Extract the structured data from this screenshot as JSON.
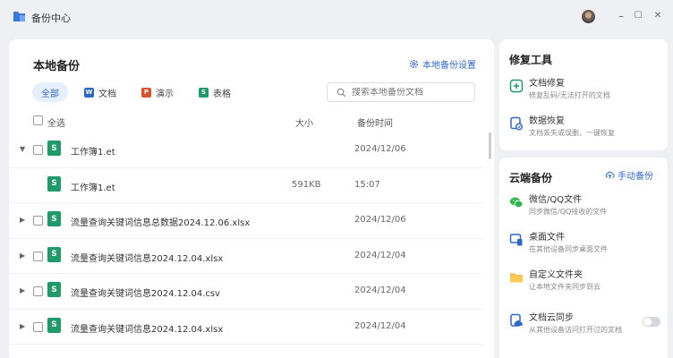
{
  "app": {
    "title": "备份中心"
  },
  "window": {
    "minimize": "–",
    "maximize": "☐",
    "close": "✕"
  },
  "main": {
    "title": "本地备份",
    "settings_label": "本地备份设置",
    "filters": [
      {
        "label": "全部",
        "active": true
      },
      {
        "label": "文档",
        "icon": "W"
      },
      {
        "label": "演示",
        "icon": "P"
      },
      {
        "label": "表格",
        "icon": "S"
      }
    ],
    "search_placeholder": "搜索本地备份文档",
    "columns": {
      "all": "全选",
      "size": "大小",
      "time": "备份时间"
    },
    "rows": [
      {
        "arrow": "▼",
        "icon": "S",
        "name": "工作簿1.et",
        "size": "",
        "time": "2024/12/06",
        "checkbox": true
      },
      {
        "arrow": "",
        "icon": "S",
        "name": "工作簿1.et",
        "size": "591KB",
        "time": "15:07",
        "checkbox": false
      },
      {
        "arrow": "▶",
        "icon": "S",
        "name": "流量查询关键词信息总数据2024.12.06.xlsx",
        "size": "",
        "time": "2024/12/06",
        "checkbox": true
      },
      {
        "arrow": "▶",
        "icon": "S",
        "name": "流量查询关键词信息2024.12.04.xlsx",
        "size": "",
        "time": "2024/12/04",
        "checkbox": true
      },
      {
        "arrow": "▶",
        "icon": "S",
        "name": "流量查询关键词信息2024.12.04.csv",
        "size": "",
        "time": "2024/12/04",
        "checkbox": true
      },
      {
        "arrow": "▶",
        "icon": "S",
        "name": "流量查询关键词信息2024.12.04.xlsx",
        "size": "",
        "time": "2024/12/04",
        "checkbox": true
      }
    ]
  },
  "repair": {
    "title": "修复工具",
    "items": [
      {
        "title": "文档修复",
        "desc": "修复乱码/无法打开的文档",
        "icon": "doc-repair-icon"
      },
      {
        "title": "数据恢复",
        "desc": "文档丢失或误删，一键恢复",
        "icon": "data-recovery-icon"
      }
    ]
  },
  "cloud": {
    "title": "云端备份",
    "manual_label": "手动备份",
    "items": [
      {
        "title": "微信/QQ文件",
        "desc": "同步微信/QQ接收的文件",
        "icon": "wechat-icon"
      },
      {
        "title": "桌面文件",
        "desc": "在其他设备同步桌面文件",
        "icon": "desktop-icon"
      },
      {
        "title": "自定义文件夹",
        "desc": "让本地文件夹同步到云",
        "icon": "folder-icon"
      },
      {
        "title": "文档云同步",
        "desc": "从其他设备访问打开过的文档",
        "icon": "cloud-sync-icon"
      }
    ]
  },
  "colors": {
    "accent": "#2f67c7",
    "sheet": "#1f9a6b",
    "word": "#2b66c9",
    "ppt": "#d9542c"
  }
}
